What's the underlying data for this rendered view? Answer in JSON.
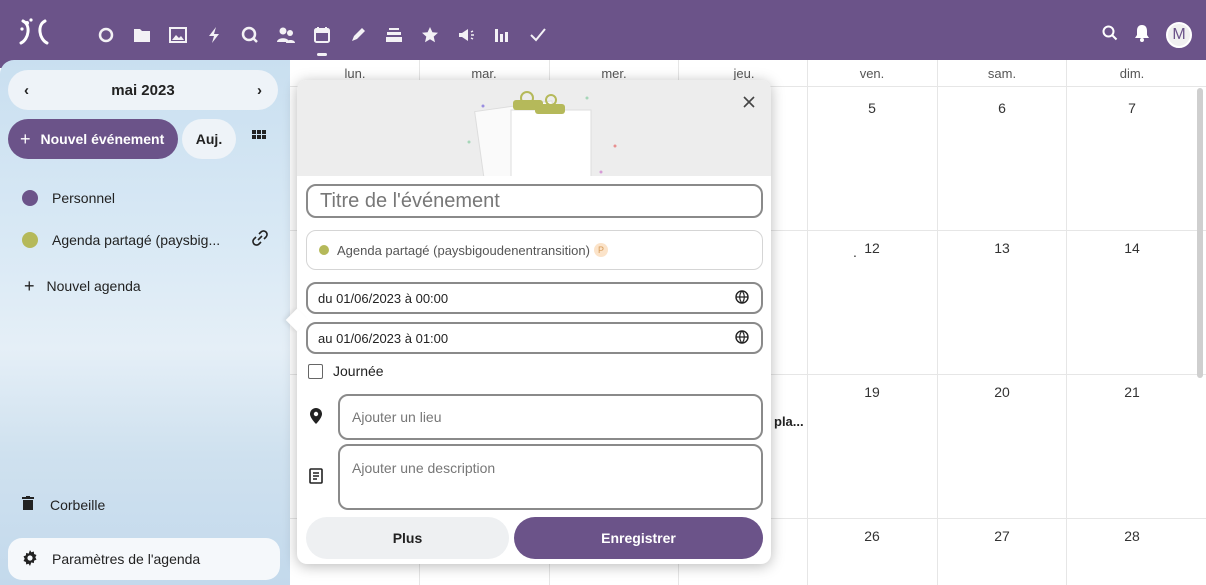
{
  "topbar": {
    "apps": [
      "circle-app-icon",
      "folder-icon",
      "image-icon",
      "bolt-icon",
      "search-app-icon",
      "contacts-icon",
      "calendar-icon",
      "pencil-icon",
      "stack-icon",
      "star-icon",
      "megaphone-icon",
      "chart-icon",
      "check-icon"
    ],
    "avatar_initial": "M",
    "brand_color": "#6b5389"
  },
  "sidebar": {
    "month": "mai 2023",
    "new_event": "Nouvel événement",
    "today": "Auj.",
    "calendars": [
      {
        "label": "Personnel",
        "color": "#6b5389"
      },
      {
        "label": "Agenda partagé (paysbig...",
        "color": "#b5b95a"
      }
    ],
    "new_calendar": "Nouvel agenda",
    "trash": "Corbeille",
    "settings": "Paramètres de l'agenda"
  },
  "grid": {
    "daynames": [
      "lun.",
      "mar.",
      "mer.",
      "jeu.",
      "ven.",
      "sam.",
      "dim."
    ],
    "week2": [
      "5",
      "6",
      "7"
    ],
    "week3": [
      ".",
      "12",
      "13",
      "14"
    ],
    "week4": [
      "19",
      "20",
      "21"
    ],
    "week5": [
      "26",
      "27",
      "28"
    ],
    "event_snippet": "pla..."
  },
  "popover": {
    "title_placeholder": "Titre de l'événement",
    "calendar": "Agenda partagé (paysbigoudenentransition)",
    "calendar_badge": "P",
    "from": "du 01/06/2023 à 00:00",
    "to": "au 01/06/2023 à 01:00",
    "all_day": "Journée",
    "location_placeholder": "Ajouter un lieu",
    "description_placeholder": "Ajouter une description",
    "more": "Plus",
    "save": "Enregistrer"
  }
}
